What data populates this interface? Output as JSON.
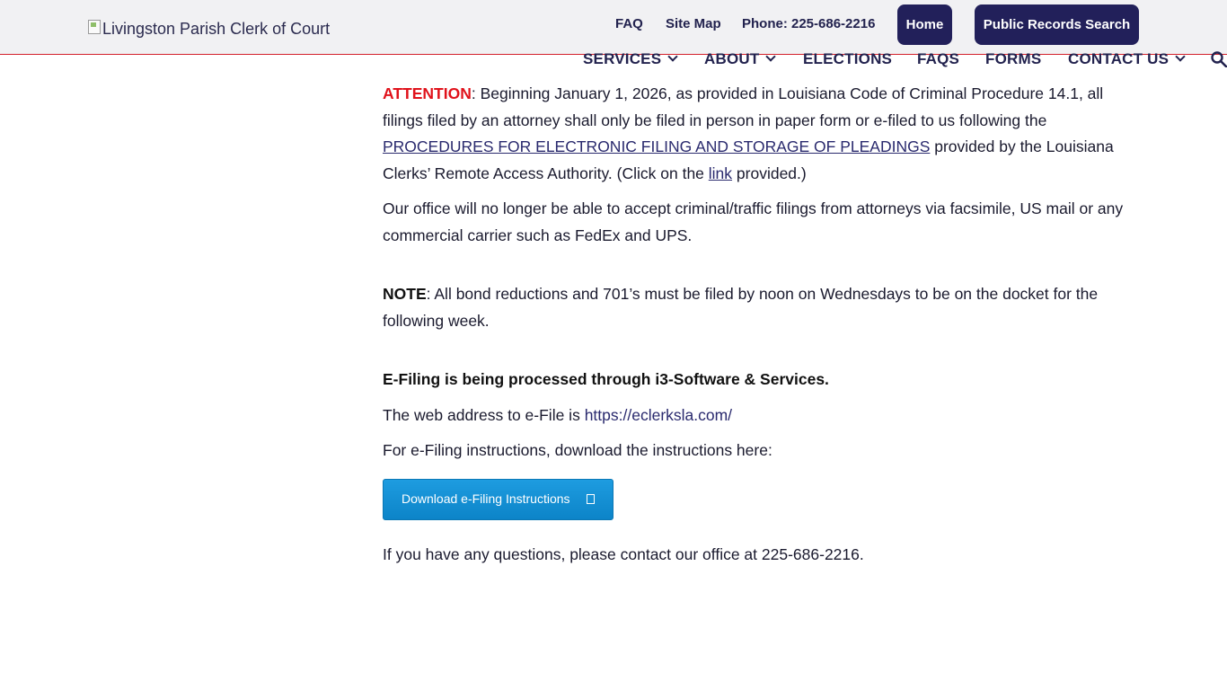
{
  "header": {
    "logo_alt": "Livingston Parish Clerk of Court",
    "faq": "FAQ",
    "site_map": "Site Map",
    "phone": "Phone: 225-686-2216",
    "home_button": "Home",
    "records_button": "Public Records Search"
  },
  "nav": {
    "services": "SERVICES",
    "about": "ABOUT",
    "elections": "ELECTIONS",
    "faqs": "FAQS",
    "forms": "FORMS",
    "contact": "CONTACT US"
  },
  "content": {
    "attention_label": "ATTENTION",
    "attention_text_1": ": Beginning January 1, 2026, as provided in Louisiana Code of Criminal Procedure 14.1, all filings filed by an attorney shall only be filed in person in paper form or e-filed to us following the ",
    "procedures_link": "PROCEDURES FOR ELECTRONIC FILING AND STORAGE OF PLEADINGS",
    "attention_text_2": " provided by the Louisiana Clerks’ Remote Access Authority. (Click on the ",
    "link_word": "link",
    "attention_text_3": " provided.)",
    "office_notice": "Our office will no longer be able to accept criminal/traffic filings from attorneys via facsimile, US mail or any commercial carrier such as FedEx and UPS.",
    "note_label": "NOTE",
    "note_text": ": All bond reductions and 701’s must be filed by noon on Wednesdays to be on the docket for the following week.",
    "efiling_heading": "E-Filing is being processed through i3-Software & Services.",
    "web_address_text": "The web address to e-File is ",
    "web_address_link": "https://eclerksla.com/",
    "instructions_text": "For e-Filing instructions, download the instructions here:",
    "download_button": "Download e-Filing Instructions",
    "questions_text": "If you have any questions, please contact our office at 225-686-2216."
  },
  "colors": {
    "accent_navy": "#22205a",
    "alert_red": "#e0121b",
    "button_blue": "#1e9ce0"
  }
}
